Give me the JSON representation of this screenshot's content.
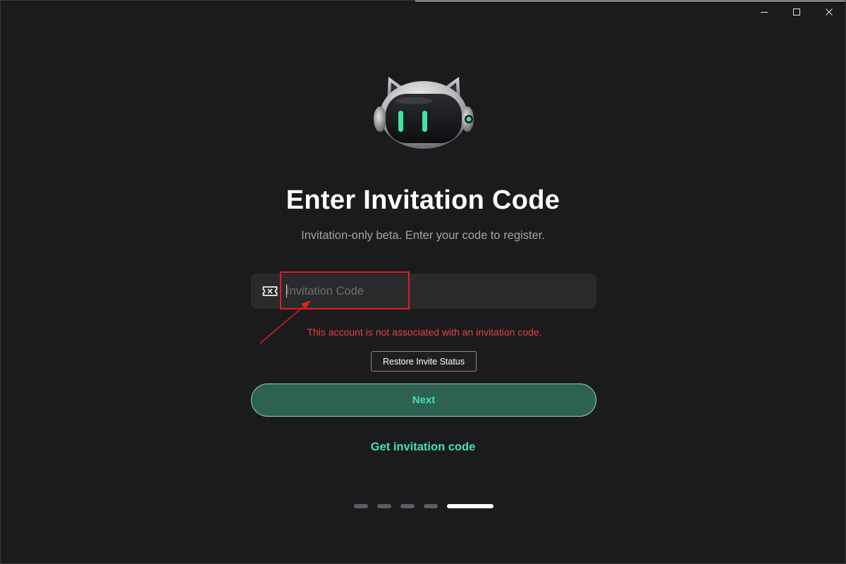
{
  "window": {
    "controls": [
      "minimize-icon",
      "maximize-icon",
      "close-icon"
    ]
  },
  "hero": {
    "mascot_icon": "robot-cat-mascot-icon",
    "title": "Enter Invitation Code",
    "subtitle": "Invitation-only beta. Enter your code to register."
  },
  "form": {
    "input_icon": "ticket-icon",
    "code_value": "",
    "code_placeholder": "Invitation Code",
    "error_message": "This account is not associated with an invitation code.",
    "restore_label": "Restore Invite Status",
    "next_label": "Next",
    "get_code_label": "Get invitation code"
  },
  "pager": {
    "total_steps": 5,
    "current_step": 5
  },
  "colors": {
    "background": "#1b1b1d",
    "accent": "#43e0b1",
    "primary_button": "#2d6152",
    "error": "#e5423f",
    "annotation": "#e0201f"
  }
}
